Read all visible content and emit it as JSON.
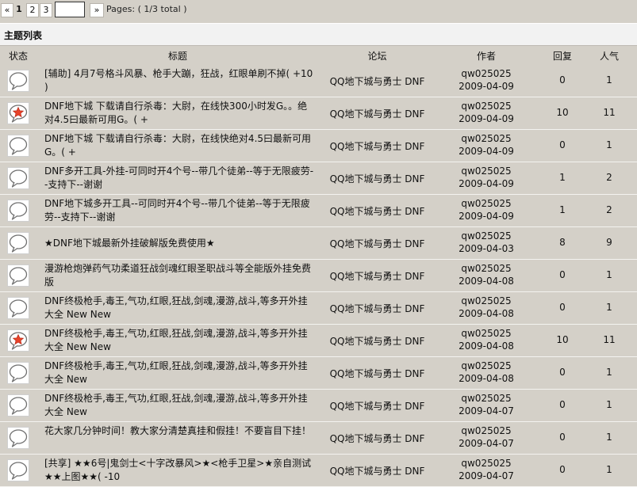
{
  "pagination": {
    "first": "«",
    "pages": [
      "1",
      "2",
      "3"
    ],
    "next": "»",
    "info": "Pages: ( 1/3 total )"
  },
  "section": {
    "title": "主题列表"
  },
  "columns": {
    "status": "状态",
    "title": "标题",
    "forum": "论坛",
    "author": "作者",
    "replies": "回复",
    "views": "人气"
  },
  "rows": [
    {
      "icon": "normal",
      "title": " [辅助] 4月7号格斗风暴、枪手大蹦，狂战，红眼单刷不掉( +10 )",
      "forum": "QQ地下城与勇士 DNF",
      "author": "qw025025",
      "date": "2009-04-09",
      "replies": "0",
      "views": "1"
    },
    {
      "icon": "hot",
      "title": " DNF地下城 下载请自行杀毒：大尉，在线快300小时发G。。绝对4.5曰最新可用G。( +",
      "forum": "QQ地下城与勇士 DNF",
      "author": "qw025025",
      "date": "2009-04-09",
      "replies": "10",
      "views": "11"
    },
    {
      "icon": "normal",
      "title": " DNF地下城 下载请自行杀毒：大尉，在线快绝对4.5曰最新可用G。( +",
      "forum": "QQ地下城与勇士 DNF",
      "author": "qw025025",
      "date": "2009-04-09",
      "replies": "0",
      "views": "1"
    },
    {
      "icon": "normal",
      "title": " DNF多开工具-外挂-可同时开4个号--带几个徒弟--等于无限疲劳--支持下--谢谢",
      "forum": "QQ地下城与勇士 DNF",
      "author": "qw025025",
      "date": "2009-04-09",
      "replies": "1",
      "views": "2"
    },
    {
      "icon": "normal",
      "title": " DNF地下城多开工具--可同时开4个号--带几个徒弟--等于无限疲劳--支持下--谢谢",
      "forum": "QQ地下城与勇士 DNF",
      "author": "qw025025",
      "date": "2009-04-09",
      "replies": "1",
      "views": "2"
    },
    {
      "icon": "normal",
      "title": " ★DNF地下城最新外挂破解版免费使用★",
      "forum": "QQ地下城与勇士 DNF",
      "author": "qw025025",
      "date": "2009-04-03",
      "replies": "8",
      "views": "9"
    },
    {
      "icon": "normal",
      "title": " 漫游枪炮弹药气功柔道狂战剑魂红眼圣职战斗等全能版外挂免费版",
      "forum": "QQ地下城与勇士 DNF",
      "author": "qw025025",
      "date": "2009-04-08",
      "replies": "0",
      "views": "1"
    },
    {
      "icon": "normal",
      "title": " DNF终极枪手,毒王,气功,红眼,狂战,剑魂,漫游,战斗,等多开外挂大全 New New",
      "forum": "QQ地下城与勇士 DNF",
      "author": "qw025025",
      "date": "2009-04-08",
      "replies": "0",
      "views": "1"
    },
    {
      "icon": "hot",
      "title": " DNF终极枪手,毒王,气功,红眼,狂战,剑魂,漫游,战斗,等多开外挂大全 New  New",
      "forum": "QQ地下城与勇士 DNF",
      "author": "qw025025",
      "date": "2009-04-08",
      "replies": "10",
      "views": "11"
    },
    {
      "icon": "normal",
      "title": " DNF终极枪手,毒王,气功,红眼,狂战,剑魂,漫游,战斗,等多开外挂大全 New",
      "forum": "QQ地下城与勇士 DNF",
      "author": "qw025025",
      "date": "2009-04-08",
      "replies": "0",
      "views": "1"
    },
    {
      "icon": "normal",
      "title": " DNF终极枪手,毒王,气功,红眼,狂战,剑魂,漫游,战斗,等多开外挂大全  New",
      "forum": "QQ地下城与勇士 DNF",
      "author": "qw025025",
      "date": "2009-04-07",
      "replies": "0",
      "views": "1"
    },
    {
      "icon": "normal",
      "title": " 花大家几分钟时间！教大家分清楚真挂和假挂！不要盲目下挂！",
      "forum": "QQ地下城与勇士 DNF",
      "author": "qw025025",
      "date": "2009-04-07",
      "replies": "0",
      "views": "1"
    },
    {
      "icon": "normal",
      "title": " [共享] ★★6号|鬼剑士<十字改暴风>★<枪手卫星>★亲自测试★★上图★★( -10",
      "forum": "QQ地下城与勇士 DNF",
      "author": "qw025025",
      "date": "2009-04-07",
      "replies": "0",
      "views": "1"
    }
  ]
}
